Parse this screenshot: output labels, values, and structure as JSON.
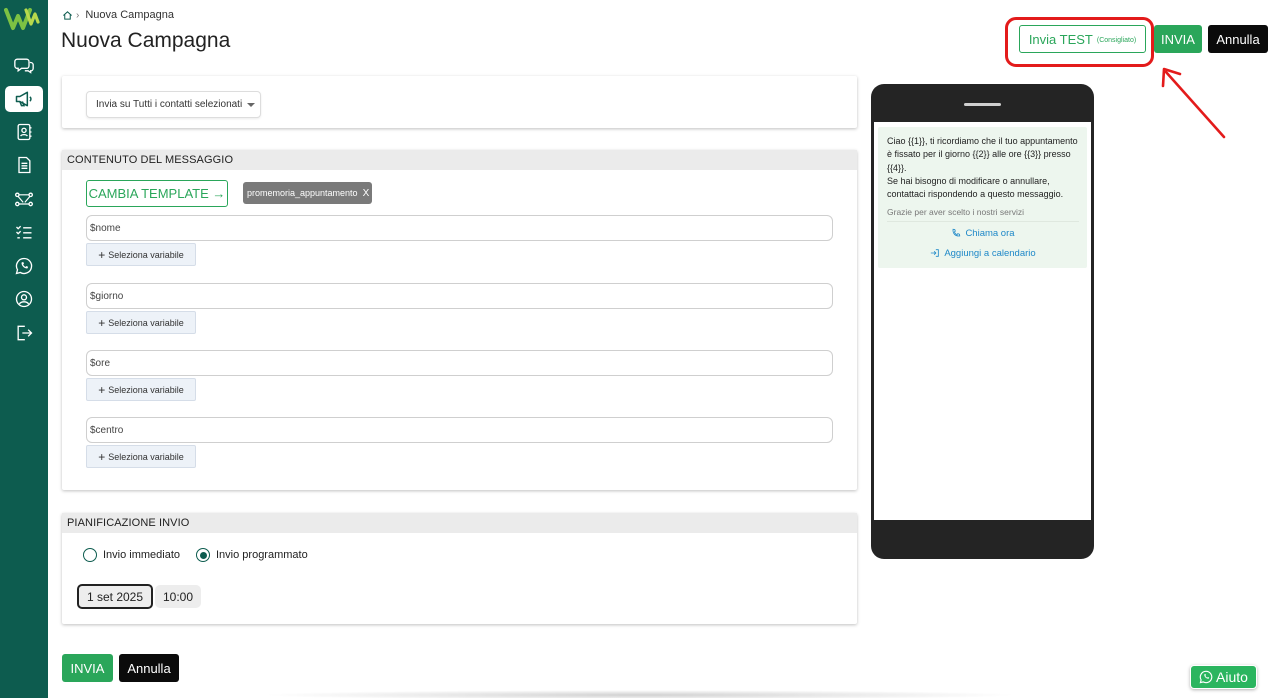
{
  "breadcrumb": {
    "current": "Nuova Campagna"
  },
  "header": {
    "title": "Nuova Campagna",
    "test_label": "Invia TEST",
    "test_sub": "(Consigliato)",
    "send_label": "INVIA",
    "cancel_label": "Annulla"
  },
  "recipients": {
    "select_value": "Invia su Tutti i contatti selezionati"
  },
  "message": {
    "section_title": "CONTENUTO DEL MESSAGGIO",
    "change_template_label": "CAMBIA TEMPLATE →",
    "template_tag": "promemoria_appuntamento",
    "template_tag_remove": "X",
    "variables": [
      {
        "value": "$nome",
        "button": "Seleziona variabile"
      },
      {
        "value": "$giorno",
        "button": "Seleziona variabile"
      },
      {
        "value": "$ore",
        "button": "Seleziona variabile"
      },
      {
        "value": "$centro",
        "button": "Seleziona variabile"
      }
    ]
  },
  "schedule": {
    "section_title": "PIANIFICAZIONE INVIO",
    "option_immediate": "Invio immediato",
    "option_scheduled": "Invio programmato",
    "selected": "scheduled",
    "date": "1 set 2025",
    "time": "10:00"
  },
  "footer": {
    "send_label": "INVIA",
    "cancel_label": "Annulla"
  },
  "preview": {
    "line1": "Ciao {{1}}, ti ricordiamo che il tuo appuntamento",
    "line2": "è fissato per il giorno {{2}} alle ore {{3}} presso",
    "line3": "{{4}}.",
    "line4": "Se hai bisogno di modificare o annullare,",
    "line5": "contattaci rispondendo a questo messaggio.",
    "footer": "Grazie per aver scelto i nostri servizi",
    "action_call": "Chiama ora",
    "action_calendar": "Aggiungi a calendario"
  },
  "help": {
    "label": "Aiuto"
  },
  "colors": {
    "sidebar": "#0d5c4f",
    "accent": "#2aa65a",
    "highlight": "#e31b1b",
    "link": "#1e88c8"
  },
  "icons": {
    "sidebar": [
      "chat-icon",
      "megaphone-icon",
      "contacts-icon",
      "document-icon",
      "flow-icon",
      "checklist-icon",
      "whatsapp-icon",
      "user-icon",
      "logout-icon"
    ]
  }
}
